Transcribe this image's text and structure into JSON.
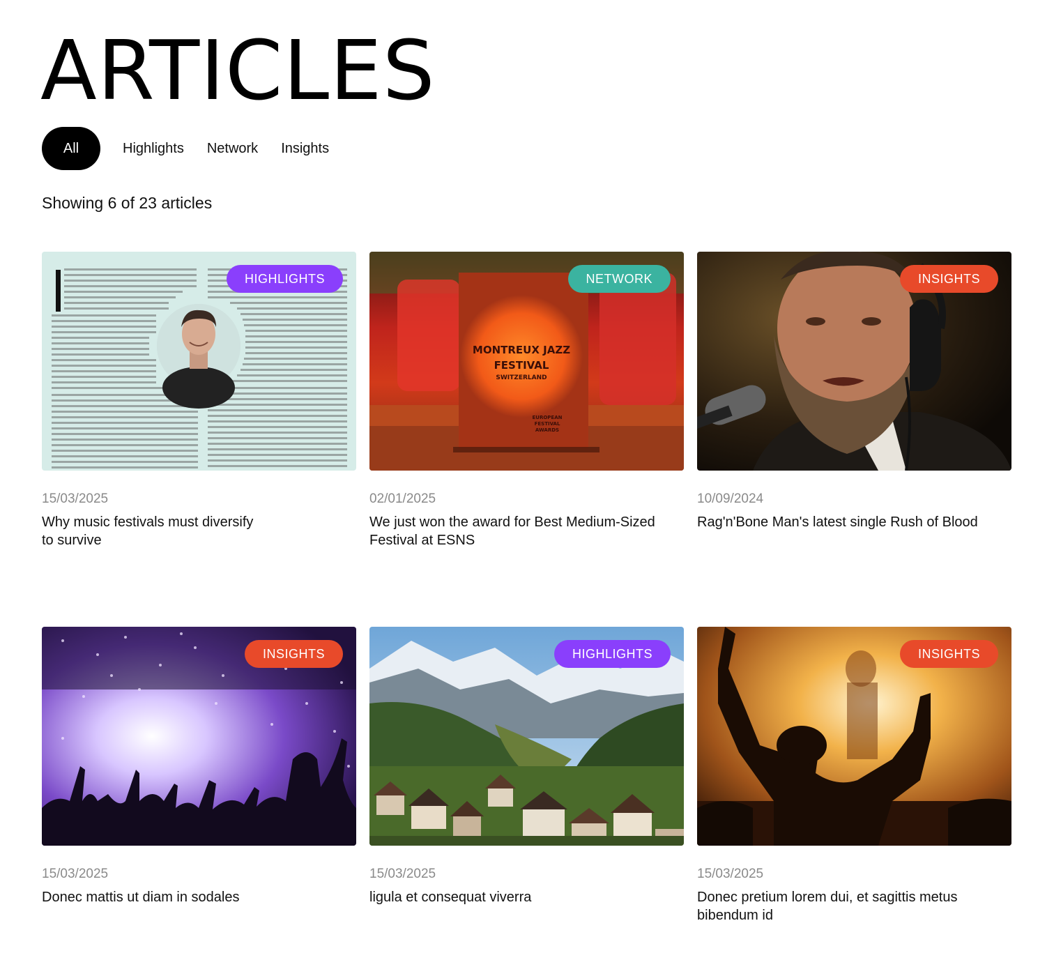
{
  "page": {
    "title": "ARTICLES"
  },
  "filters": [
    {
      "label": "All",
      "active": true
    },
    {
      "label": "Highlights",
      "active": false
    },
    {
      "label": "Network",
      "active": false
    },
    {
      "label": "Insights",
      "active": false
    }
  ],
  "count_text": "Showing 6 of 23 articles",
  "tag_colors": {
    "HIGHLIGHTS": "#8a3ffc",
    "NETWORK": "#3bb3a0",
    "INSIGHTS": "#e84a2a"
  },
  "articles": [
    {
      "tag": "HIGHLIGHTS",
      "date": "15/03/2025",
      "title": "Why music festivals must diversify to survive",
      "image": "newspaper-portrait"
    },
    {
      "tag": "NETWORK",
      "date": "02/01/2025",
      "title": "We just won the award for Best Medium-Sized Festival at ESNS",
      "image": "award-trophy",
      "image_text": [
        "MONTREUX JAZZ",
        "FESTIVAL",
        "SWITZERLAND",
        "EUROPEAN",
        "FESTIVAL",
        "AWARDS"
      ]
    },
    {
      "tag": "INSIGHTS",
      "date": "10/09/2024",
      "title": "Rag'n'Bone Man's latest single Rush of Blood",
      "image": "singer-microphone"
    },
    {
      "tag": "INSIGHTS",
      "date": "15/03/2025",
      "title": "Donec mattis ut diam in sodales",
      "image": "confetti-crowd"
    },
    {
      "tag": "HIGHLIGHTS",
      "date": "15/03/2025",
      "title": "ligula et consequat viverra",
      "image": "mountain-village"
    },
    {
      "tag": "INSIGHTS",
      "date": "15/03/2025",
      "title": "Donec pretium lorem dui, et sagittis metus bibendum id",
      "image": "concert-silhouette"
    }
  ]
}
